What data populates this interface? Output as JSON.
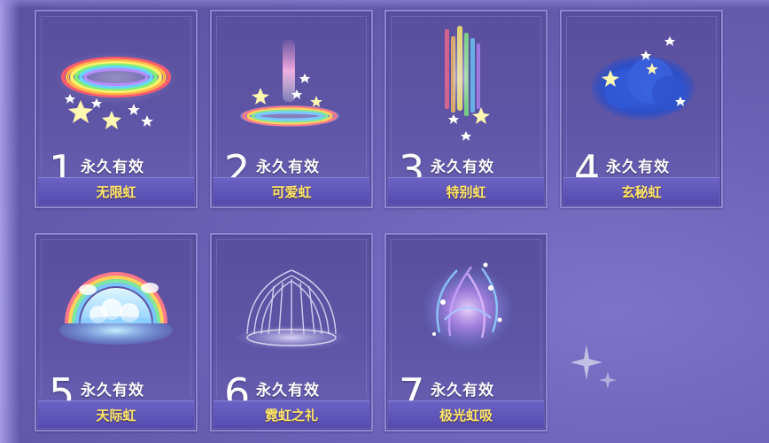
{
  "items": [
    {
      "number": "1",
      "validity": "永久有效",
      "name": "无限虹"
    },
    {
      "number": "2",
      "validity": "永久有效",
      "name": "可爱虹"
    },
    {
      "number": "3",
      "validity": "永久有效",
      "name": "特别虹"
    },
    {
      "number": "4",
      "validity": "永久有效",
      "name": "玄秘虹"
    },
    {
      "number": "5",
      "validity": "永久有效",
      "name": "天际虹"
    },
    {
      "number": "6",
      "validity": "永久有效",
      "name": "霓虹之礼"
    },
    {
      "number": "7",
      "validity": "永久有效",
      "name": "极光虹吸"
    }
  ],
  "colors": {
    "label_text": "#ffe86a",
    "validity_text": "#ffffff",
    "card_border": "#8e86d1",
    "background": "#6a61b6"
  },
  "icons": [
    "rainbow-ring-icon",
    "cute-rainbow-icon",
    "special-rainbow-icon",
    "mystic-cloud-icon",
    "sky-rainbow-icon",
    "neon-gift-icon",
    "aurora-icon"
  ]
}
